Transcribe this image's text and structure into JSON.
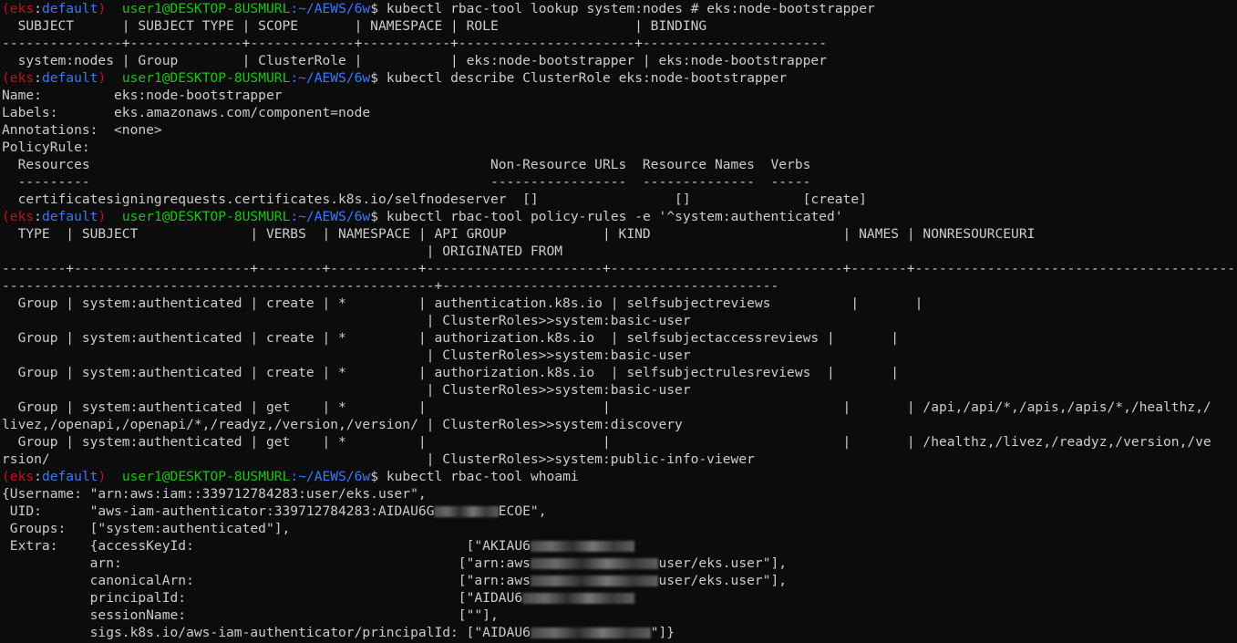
{
  "prompt": {
    "paren_open": "(",
    "env": "eks",
    "colon": ":",
    "context": "default",
    "paren_close": ")",
    "user_host": "user1@DESKTOP-8USMURL",
    "path": ":~/AEWS/6w",
    "dollar": "$"
  },
  "lines": [
    {
      "type": "prompt",
      "cmd": " kubectl rbac-tool lookup system:nodes # eks:node-bootstrapper"
    },
    {
      "type": "out",
      "text": "  SUBJECT      | SUBJECT TYPE | SCOPE       | NAMESPACE | ROLE                 | BINDING"
    },
    {
      "type": "out",
      "text": "---------------+--------------+-------------+-----------+----------------------+-----------------------"
    },
    {
      "type": "out",
      "text": "  system:nodes | Group        | ClusterRole |           | eks:node-bootstrapper | eks:node-bootstrapper"
    },
    {
      "type": "prompt",
      "cmd": " kubectl describe ClusterRole eks:node-bootstrapper"
    },
    {
      "type": "out",
      "text": "Name:         eks:node-bootstrapper"
    },
    {
      "type": "out",
      "text": "Labels:       eks.amazonaws.com/component=node"
    },
    {
      "type": "out",
      "text": "Annotations:  <none>"
    },
    {
      "type": "out",
      "text": "PolicyRule:"
    },
    {
      "type": "out",
      "text": "  Resources                                                  Non-Resource URLs  Resource Names  Verbs"
    },
    {
      "type": "out",
      "text": "  ---------                                                  -----------------  --------------  -----"
    },
    {
      "type": "out",
      "text": "  certificatesigningrequests.certificates.k8s.io/selfnodeserver  []                 []              [create]"
    },
    {
      "type": "prompt",
      "cmd": " kubectl rbac-tool policy-rules -e '^system:authenticated'"
    },
    {
      "type": "out",
      "text": "  TYPE  | SUBJECT              | VERBS  | NAMESPACE | API GROUP            | KIND                        | NAMES | NONRESOURCEURI"
    },
    {
      "type": "out",
      "text": "                                                     | ORIGINATED FROM"
    },
    {
      "type": "out",
      "text": "--------+----------------------+--------+-----------+----------------------+-----------------------------+-------+----------------------------------------"
    },
    {
      "type": "out",
      "text": "------------------------------------------------------+------------------------------------------"
    },
    {
      "type": "out",
      "text": "  Group | system:authenticated | create | *         | authentication.k8s.io | selfsubjectreviews          |       |"
    },
    {
      "type": "out",
      "text": "                                                     | ClusterRoles>>system:basic-user"
    },
    {
      "type": "out",
      "text": "  Group | system:authenticated | create | *         | authorization.k8s.io  | selfsubjectaccessreviews |       |"
    },
    {
      "type": "out",
      "text": "                                                     | ClusterRoles>>system:basic-user"
    },
    {
      "type": "out",
      "text": "  Group | system:authenticated | create | *         | authorization.k8s.io  | selfsubjectrulesreviews  |       |"
    },
    {
      "type": "out",
      "text": "                                                     | ClusterRoles>>system:basic-user"
    },
    {
      "type": "out",
      "text": "  Group | system:authenticated | get    | *         |                      |                             |       | /api,/api/*,/apis,/apis/*,/healthz,/"
    },
    {
      "type": "out",
      "text": "livez,/openapi,/openapi/*,/readyz,/version,/version/ | ClusterRoles>>system:discovery"
    },
    {
      "type": "out",
      "text": "  Group | system:authenticated | get    | *         |                      |                             |       | /healthz,/livez,/readyz,/version,/ve"
    },
    {
      "type": "out",
      "text": "rsion/                                               | ClusterRoles>>system:public-info-viewer"
    },
    {
      "type": "prompt",
      "cmd": " kubectl rbac-tool whoami"
    },
    {
      "type": "out",
      "text": "{Username: \"arn:aws:iam::339712784283:user/eks.user\","
    },
    {
      "type": "mixed",
      "before": " UID:      \"aws-iam-authenticator:339712784283:AIDAU6G",
      "redacted": "MAAAMAAA",
      "after": "ECOE\","
    },
    {
      "type": "out",
      "text": " Groups:   [\"system:authenticated\"],"
    },
    {
      "type": "mixed",
      "before": " Extra:    {accessKeyId:                                  [\"AKIAU6",
      "redacted": "XXXXXXXXXXXXX",
      "after": ""
    },
    {
      "type": "mixed",
      "before": "           arn:                                          [\"arn:aws",
      "redacted": "XXXXXXXXXXXXXXXX",
      "after": "user/eks.user\"],"
    },
    {
      "type": "mixed",
      "before": "           canonicalArn:                                 [\"arn:aws",
      "redacted": "XXXXXXXXXXXXXXXX",
      "after": "user/eks.user\"],"
    },
    {
      "type": "mixed",
      "before": "           principalId:                                  [\"AIDAU6",
      "redacted": "XXXXXXXXXXXXXX",
      "after": ""
    },
    {
      "type": "out",
      "text": "           sessionName:                                  [\"\"],"
    },
    {
      "type": "mixed",
      "before": "           sigs.k8s.io/aws-iam-authenticator/principalId: [\"AIDAU6",
      "redacted": "XXXXXXXXXXXXXXX",
      "after": "\"]}"
    }
  ]
}
